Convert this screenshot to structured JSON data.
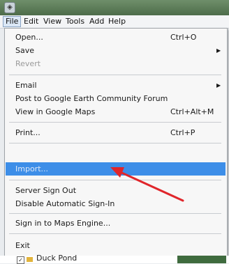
{
  "menubar": {
    "items": [
      "File",
      "Edit",
      "View",
      "Tools",
      "Add",
      "Help"
    ]
  },
  "file_menu": {
    "open": {
      "label": "Open...",
      "shortcut": "Ctrl+O"
    },
    "save": {
      "label": "Save"
    },
    "revert": {
      "label": "Revert"
    },
    "email": {
      "label": "Email"
    },
    "post_forum": {
      "label": "Post to Google Earth Community Forum"
    },
    "view_maps": {
      "label": "View in Google Maps",
      "shortcut": "Ctrl+Alt+M"
    },
    "print": {
      "label": "Print...",
      "shortcut": "Ctrl+P"
    },
    "import": {
      "label": "Import..."
    },
    "server_sign_out": {
      "label": "Server Sign Out"
    },
    "disable_signin": {
      "label": "Disable Automatic Sign-In"
    },
    "maps_engine": {
      "label": "Sign in to Maps Engine..."
    },
    "exit": {
      "label": "Exit"
    }
  },
  "background": {
    "places_item": "Duck Pond"
  },
  "colors": {
    "highlight": "#3d8ee8",
    "annotation_arrow": "#e0262b"
  }
}
